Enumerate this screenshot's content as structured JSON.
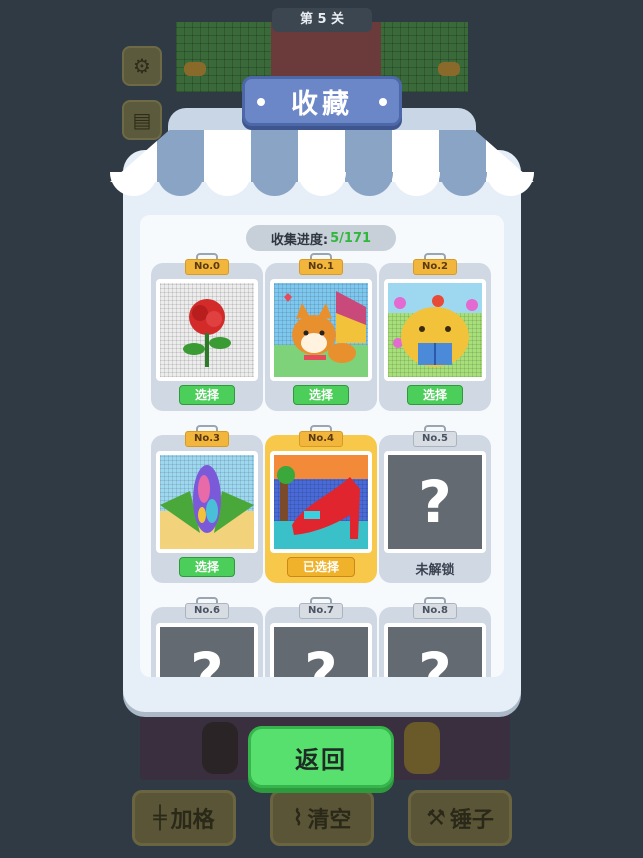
{
  "level_label": "第 5 关",
  "title": "收藏",
  "progress": {
    "label": "收集进度:",
    "value": "5/171"
  },
  "items": [
    {
      "tag": "No.0",
      "state": "unlocked",
      "button": "选择",
      "picture": "rose"
    },
    {
      "tag": "No.1",
      "state": "unlocked",
      "button": "选择",
      "picture": "shiba-dog"
    },
    {
      "tag": "No.2",
      "state": "unlocked",
      "button": "选择",
      "picture": "capybara"
    },
    {
      "tag": "No.3",
      "state": "unlocked",
      "button": "选择",
      "picture": "corn"
    },
    {
      "tag": "No.4",
      "state": "selected",
      "button": "已选择",
      "picture": "red-high-heel"
    },
    {
      "tag": "No.5",
      "state": "locked",
      "button": "未解锁",
      "picture": "?"
    },
    {
      "tag": "No.6",
      "state": "locked",
      "button": "",
      "picture": "?"
    },
    {
      "tag": "No.7",
      "state": "locked",
      "button": "",
      "picture": "?"
    },
    {
      "tag": "No.8",
      "state": "locked",
      "button": "",
      "picture": "?"
    }
  ],
  "back_button": "返回",
  "tools": [
    {
      "label": "加格",
      "icon": "dumbbell-icon"
    },
    {
      "label": "清空",
      "icon": "broom-icon"
    },
    {
      "label": "锤子",
      "icon": "hammer-icon"
    }
  ],
  "colors": {
    "background": "#2f3a44",
    "panel": "#e6eef7",
    "select_button": "#4ccf5a",
    "selected_card": "#f7c84a",
    "title_banner": "#6c87c8",
    "back_button": "#58e06e",
    "progress_value": "#2fb83a"
  }
}
